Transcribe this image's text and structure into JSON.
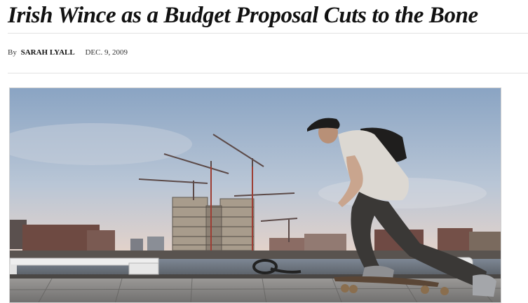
{
  "article": {
    "headline": "Irish Wince as a Budget Proposal Cuts to the Bone",
    "byline": {
      "prefix": "By",
      "author": "SARAH LYALL",
      "date": "DEC. 9, 2009"
    },
    "photo": {
      "subject": "skateboarder-on-quay",
      "colors": {
        "sky_top": "#8fa8c6",
        "sky_bottom": "#e9d2c6",
        "ground": "#8c8c8c",
        "silhouette": "#2f2d2c"
      }
    }
  }
}
